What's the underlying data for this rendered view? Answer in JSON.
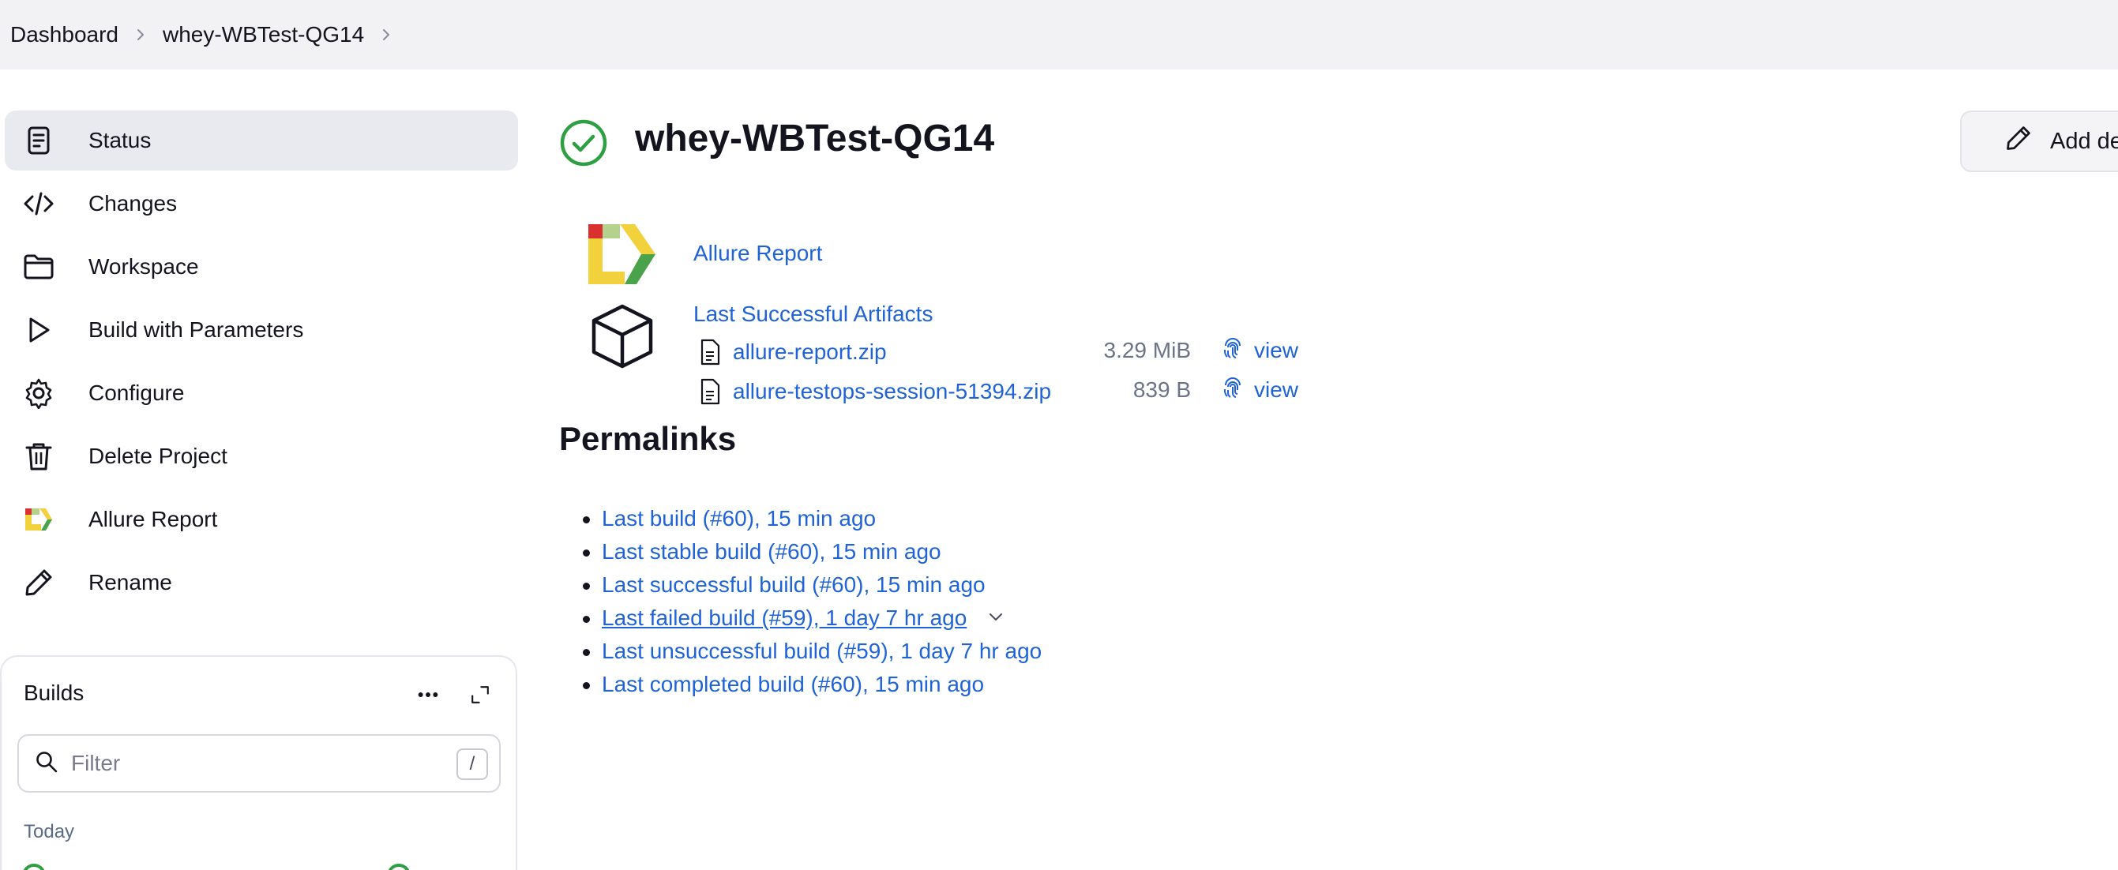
{
  "breadcrumb": {
    "items": [
      "Dashboard",
      "whey-WBTest-QG14"
    ]
  },
  "sidebar": {
    "items": [
      {
        "label": "Status",
        "icon": "status-icon",
        "active": true
      },
      {
        "label": "Changes",
        "icon": "code-icon"
      },
      {
        "label": "Workspace",
        "icon": "folder-icon"
      },
      {
        "label": "Build with Parameters",
        "icon": "play-icon"
      },
      {
        "label": "Configure",
        "icon": "gear-icon"
      },
      {
        "label": "Delete Project",
        "icon": "trash-icon"
      },
      {
        "label": "Allure Report",
        "icon": "allure-logo-icon"
      },
      {
        "label": "Rename",
        "icon": "pencil-icon"
      }
    ]
  },
  "builds": {
    "title": "Builds",
    "filter_placeholder": "Filter",
    "shortcut": "/",
    "group_label": "Today"
  },
  "main": {
    "title": "whey-WBTest-QG14",
    "status": "success",
    "add_description_label": "Add description",
    "allure_link": "Allure Report",
    "artifacts_link": "Last Successful Artifacts",
    "artifacts": [
      {
        "name": "allure-report.zip",
        "size": "3.29 MiB",
        "view": "view"
      },
      {
        "name": "allure-testops-session-51394.zip",
        "size": "839 B",
        "view": "view"
      }
    ],
    "permalinks_title": "Permalinks",
    "permalinks": [
      "Last build (#60), 15 min ago",
      "Last stable build (#60), 15 min ago",
      "Last successful build (#60), 15 min ago",
      "Last failed build (#59), 1 day 7 hr ago",
      "Last unsuccessful build (#59), 1 day 7 hr ago",
      "Last completed build (#60), 15 min ago"
    ]
  },
  "colors": {
    "link": "#1f63d6",
    "success": "#2ea043",
    "topbar_bg": "#f2f2f5",
    "active_bg": "#e9eaf0"
  }
}
